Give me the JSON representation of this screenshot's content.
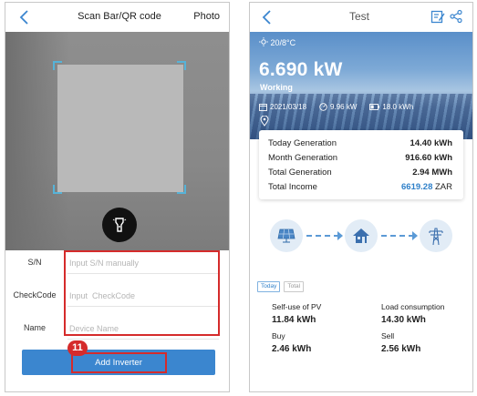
{
  "left": {
    "header": {
      "title": "Scan Bar/QR code",
      "photo_label": "Photo"
    },
    "form": {
      "sn": {
        "label": "S/N",
        "placeholder": "Input S/N manually"
      },
      "checkcode": {
        "label": "CheckCode",
        "placeholder": "Input  CheckCode"
      },
      "name": {
        "label": "Name",
        "placeholder": "Device Name"
      }
    },
    "add_button": "Add Inverter",
    "step_badge": "11"
  },
  "right": {
    "header": {
      "title": "Test"
    },
    "hero": {
      "weather": "20/8°C",
      "power": "6.690 kW",
      "status": "Working",
      "date": "2021/03/18",
      "capacity": "9.96 kW",
      "battery": "18.0 kWh"
    },
    "stats": [
      {
        "label": "Today Generation",
        "value": "14.40 kWh"
      },
      {
        "label": "Month Generation",
        "value": "916.60 kWh"
      },
      {
        "label": "Total Generation",
        "value": "2.94 MWh"
      },
      {
        "label": "Total Income",
        "value": "6619.28",
        "unit": "ZAR"
      }
    ],
    "tabs": [
      "Today",
      "Total"
    ],
    "energy": [
      {
        "label": "Self-use of PV",
        "value": "11.84 kWh"
      },
      {
        "label": "Load consumption",
        "value": "14.30 kWh"
      },
      {
        "label": "Buy",
        "value": "2.46 kWh"
      },
      {
        "label": "Sell",
        "value": "2.56 kWh"
      }
    ]
  },
  "colors": {
    "accent": "#3b86cf",
    "highlight": "#d52b2b",
    "income": "#2f80c9"
  }
}
